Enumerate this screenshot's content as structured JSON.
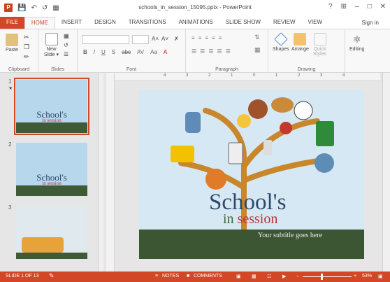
{
  "app": {
    "title": "schools_in_session_15095.pptx - PowerPoint",
    "window_controls": [
      "?",
      "⊞",
      "–",
      "□",
      "✕"
    ]
  },
  "qat": [
    "↶",
    "↷",
    "↺",
    "▦"
  ],
  "tabs": [
    "FILE",
    "HOME",
    "INSERT",
    "DESIGN",
    "TRANSITIONS",
    "ANIMATIONS",
    "SLIDE SHOW",
    "REVIEW",
    "VIEW"
  ],
  "signin": "Sign in",
  "ribbon": {
    "clipboard": {
      "label": "Clipboard",
      "paste": "Paste"
    },
    "slides": {
      "label": "Slides",
      "new_slide": "New\nSlide ▾"
    },
    "font": {
      "label": "Font",
      "buttons": [
        "B",
        "I",
        "U",
        "S",
        "abc",
        "AV",
        "Aa",
        "A"
      ]
    },
    "paragraph": {
      "label": "Paragraph"
    },
    "drawing": {
      "label": "Drawing",
      "shapes": "Shapes",
      "arrange": "Arrange",
      "quick_styles": "Quick\nStyles"
    },
    "editing": {
      "label": "Editing"
    }
  },
  "thumbnails": [
    {
      "num": "1",
      "title": "School's",
      "sub": "in session",
      "selected": true
    },
    {
      "num": "2",
      "title": "School's",
      "sub": "in session",
      "selected": false
    },
    {
      "num": "3",
      "title": "",
      "sub": "",
      "selected": false
    }
  ],
  "ruler_numbers": [
    "4",
    "3",
    "2",
    "1",
    "0",
    "1",
    "2",
    "3",
    "4"
  ],
  "slide": {
    "title": "School's",
    "subtitle_a": "in ",
    "subtitle_b": "session",
    "tagline": "Your subtitle goes here",
    "title_color": "#2d4a6b",
    "sub_a_color": "#3f6b3a",
    "sub_b_color": "#b8323a"
  },
  "status": {
    "slide": "SLIDE 1 OF 13",
    "notes": "NOTES",
    "comments": "COMMENTS",
    "zoom": "53%"
  },
  "colors": {
    "accent": "#d24726",
    "band": "#3c5532"
  }
}
